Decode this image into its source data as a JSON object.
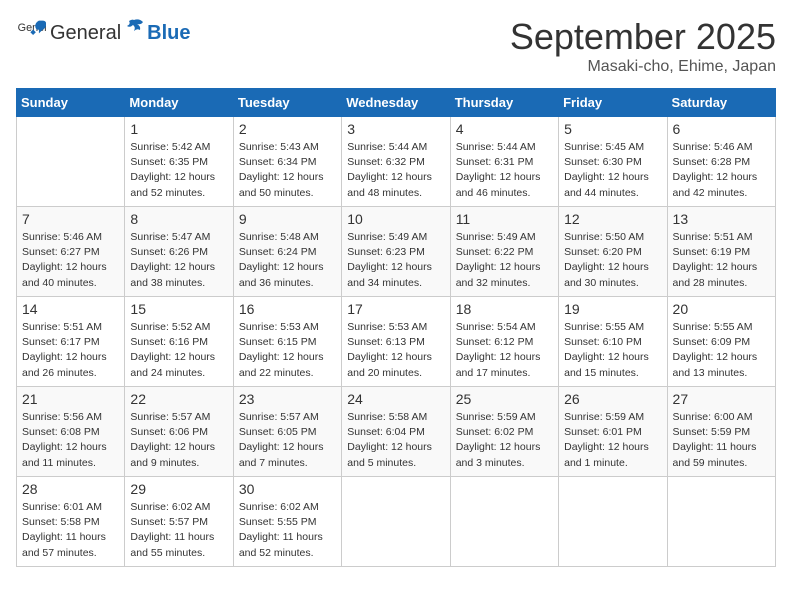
{
  "header": {
    "logo_general": "General",
    "logo_blue": "Blue",
    "month": "September 2025",
    "location": "Masaki-cho, Ehime, Japan"
  },
  "weekdays": [
    "Sunday",
    "Monday",
    "Tuesday",
    "Wednesday",
    "Thursday",
    "Friday",
    "Saturday"
  ],
  "weeks": [
    [
      {
        "day": null
      },
      {
        "day": "1",
        "sunrise": "5:42 AM",
        "sunset": "6:35 PM",
        "daylight": "12 hours and 52 minutes."
      },
      {
        "day": "2",
        "sunrise": "5:43 AM",
        "sunset": "6:34 PM",
        "daylight": "12 hours and 50 minutes."
      },
      {
        "day": "3",
        "sunrise": "5:44 AM",
        "sunset": "6:32 PM",
        "daylight": "12 hours and 48 minutes."
      },
      {
        "day": "4",
        "sunrise": "5:44 AM",
        "sunset": "6:31 PM",
        "daylight": "12 hours and 46 minutes."
      },
      {
        "day": "5",
        "sunrise": "5:45 AM",
        "sunset": "6:30 PM",
        "daylight": "12 hours and 44 minutes."
      },
      {
        "day": "6",
        "sunrise": "5:46 AM",
        "sunset": "6:28 PM",
        "daylight": "12 hours and 42 minutes."
      }
    ],
    [
      {
        "day": "7",
        "sunrise": "5:46 AM",
        "sunset": "6:27 PM",
        "daylight": "12 hours and 40 minutes."
      },
      {
        "day": "8",
        "sunrise": "5:47 AM",
        "sunset": "6:26 PM",
        "daylight": "12 hours and 38 minutes."
      },
      {
        "day": "9",
        "sunrise": "5:48 AM",
        "sunset": "6:24 PM",
        "daylight": "12 hours and 36 minutes."
      },
      {
        "day": "10",
        "sunrise": "5:49 AM",
        "sunset": "6:23 PM",
        "daylight": "12 hours and 34 minutes."
      },
      {
        "day": "11",
        "sunrise": "5:49 AM",
        "sunset": "6:22 PM",
        "daylight": "12 hours and 32 minutes."
      },
      {
        "day": "12",
        "sunrise": "5:50 AM",
        "sunset": "6:20 PM",
        "daylight": "12 hours and 30 minutes."
      },
      {
        "day": "13",
        "sunrise": "5:51 AM",
        "sunset": "6:19 PM",
        "daylight": "12 hours and 28 minutes."
      }
    ],
    [
      {
        "day": "14",
        "sunrise": "5:51 AM",
        "sunset": "6:17 PM",
        "daylight": "12 hours and 26 minutes."
      },
      {
        "day": "15",
        "sunrise": "5:52 AM",
        "sunset": "6:16 PM",
        "daylight": "12 hours and 24 minutes."
      },
      {
        "day": "16",
        "sunrise": "5:53 AM",
        "sunset": "6:15 PM",
        "daylight": "12 hours and 22 minutes."
      },
      {
        "day": "17",
        "sunrise": "5:53 AM",
        "sunset": "6:13 PM",
        "daylight": "12 hours and 20 minutes."
      },
      {
        "day": "18",
        "sunrise": "5:54 AM",
        "sunset": "6:12 PM",
        "daylight": "12 hours and 17 minutes."
      },
      {
        "day": "19",
        "sunrise": "5:55 AM",
        "sunset": "6:10 PM",
        "daylight": "12 hours and 15 minutes."
      },
      {
        "day": "20",
        "sunrise": "5:55 AM",
        "sunset": "6:09 PM",
        "daylight": "12 hours and 13 minutes."
      }
    ],
    [
      {
        "day": "21",
        "sunrise": "5:56 AM",
        "sunset": "6:08 PM",
        "daylight": "12 hours and 11 minutes."
      },
      {
        "day": "22",
        "sunrise": "5:57 AM",
        "sunset": "6:06 PM",
        "daylight": "12 hours and 9 minutes."
      },
      {
        "day": "23",
        "sunrise": "5:57 AM",
        "sunset": "6:05 PM",
        "daylight": "12 hours and 7 minutes."
      },
      {
        "day": "24",
        "sunrise": "5:58 AM",
        "sunset": "6:04 PM",
        "daylight": "12 hours and 5 minutes."
      },
      {
        "day": "25",
        "sunrise": "5:59 AM",
        "sunset": "6:02 PM",
        "daylight": "12 hours and 3 minutes."
      },
      {
        "day": "26",
        "sunrise": "5:59 AM",
        "sunset": "6:01 PM",
        "daylight": "12 hours and 1 minute."
      },
      {
        "day": "27",
        "sunrise": "6:00 AM",
        "sunset": "5:59 PM",
        "daylight": "11 hours and 59 minutes."
      }
    ],
    [
      {
        "day": "28",
        "sunrise": "6:01 AM",
        "sunset": "5:58 PM",
        "daylight": "11 hours and 57 minutes."
      },
      {
        "day": "29",
        "sunrise": "6:02 AM",
        "sunset": "5:57 PM",
        "daylight": "11 hours and 55 minutes."
      },
      {
        "day": "30",
        "sunrise": "6:02 AM",
        "sunset": "5:55 PM",
        "daylight": "11 hours and 52 minutes."
      },
      {
        "day": null
      },
      {
        "day": null
      },
      {
        "day": null
      },
      {
        "day": null
      }
    ]
  ],
  "labels": {
    "sunrise": "Sunrise:",
    "sunset": "Sunset:",
    "daylight": "Daylight:"
  }
}
